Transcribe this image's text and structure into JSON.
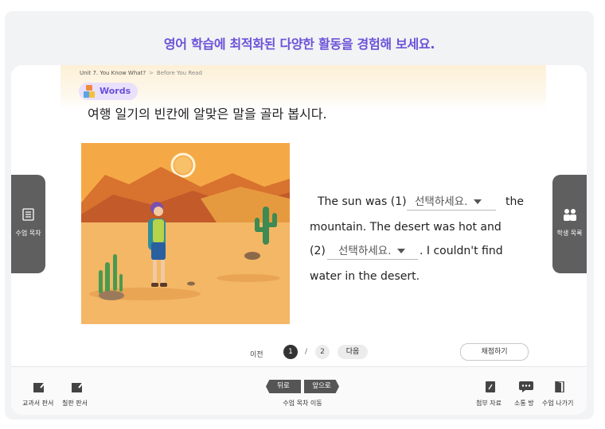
{
  "headline": "영어 학습에 최적화된 다양한 활동을 경험해 보세요.",
  "breadcrumb": {
    "unit": "Unit 7.  You Know What?",
    "separator": ">",
    "section": "Before You Read"
  },
  "badge": {
    "label": "Words",
    "icon": "blocks-icon"
  },
  "instruction": "여행 일기의 빈칸에 알맞은 말을 골라 봅시다.",
  "passage": {
    "line1_a": "The sun was (1)",
    "line1_b": "the",
    "line2": "mountain. The desert was hot and",
    "line3_a": "(2)",
    "line3_b": ". I couldn't find",
    "line4": "water in the desert.",
    "dropdown1": {
      "value": "선택하세요."
    },
    "dropdown2": {
      "value": "선택하세요."
    }
  },
  "left_tab": {
    "label": "수업 목차",
    "icon": "list-icon"
  },
  "right_tab": {
    "label": "학생 목록",
    "icon": "students-icon"
  },
  "pager": {
    "prev": "이전",
    "current": "1",
    "separator": "/",
    "total": "2",
    "next": "다음",
    "grade": "채점하기"
  },
  "bottom": {
    "textbook_board": "교과서 판서",
    "blackboard_board": "칠판 판서",
    "back": "뒤로",
    "forward": "앞으로",
    "nav_label": "수업 목차 이동",
    "attachments": "첨부 자료",
    "chat_room": "소통 방",
    "exit_class": "수업 나가기"
  },
  "colors": {
    "accent": "#6b52d8",
    "badge_bg": "#e9e0fb",
    "sky": "#f6b14e",
    "tab": "#5f5f5f"
  }
}
